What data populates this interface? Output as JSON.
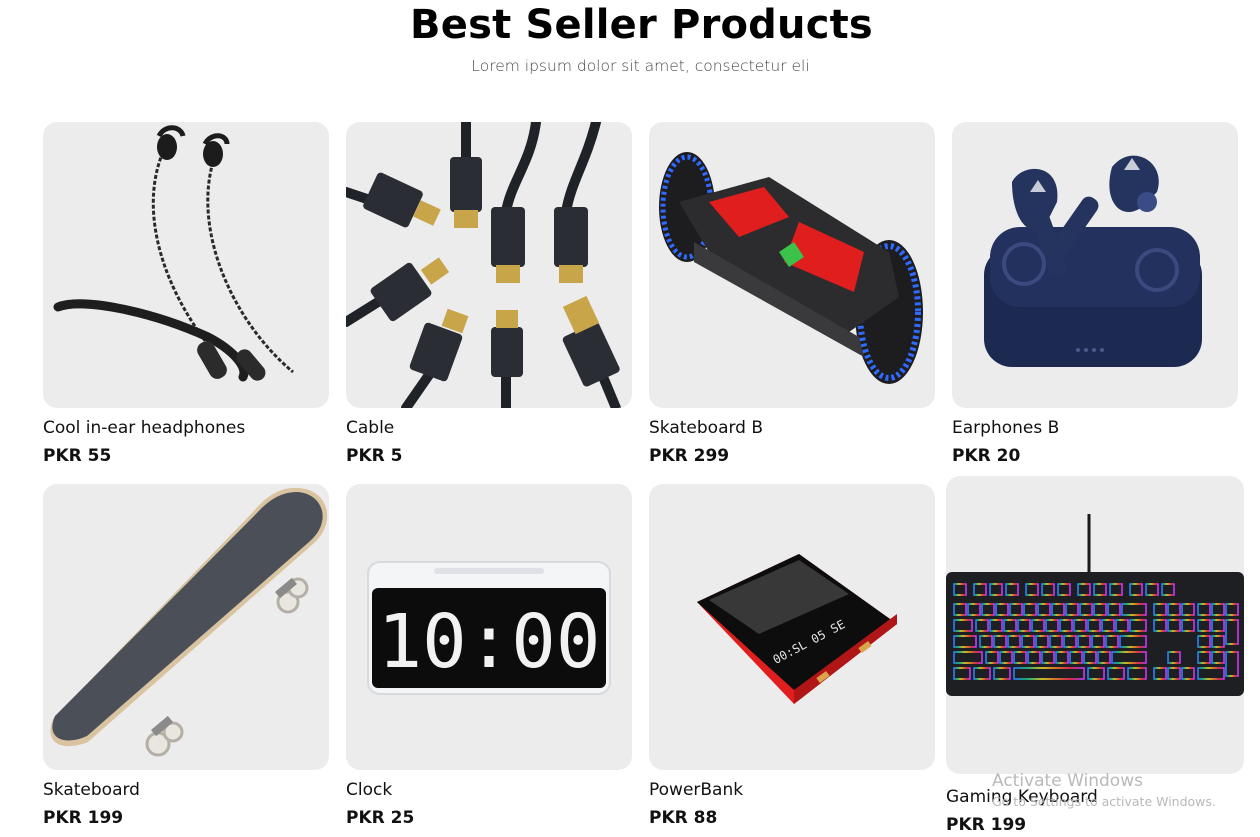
{
  "section": {
    "title": "Best Seller Products",
    "subtitle": "Lorem ipsum dolor sit amet, consectetur eli"
  },
  "products": [
    {
      "name": "Cool in-ear headphones",
      "price": "PKR 55",
      "icon": "neckband-headphones-image"
    },
    {
      "name": "Cable",
      "price": "PKR 5",
      "icon": "hdmi-cable-image"
    },
    {
      "name": "Skateboard B",
      "price": "PKR 299",
      "icon": "hoverboard-image"
    },
    {
      "name": "Earphones B",
      "price": "PKR 20",
      "icon": "earbuds-case-image"
    },
    {
      "name": "Skateboard",
      "price": "PKR 199",
      "icon": "skateboard-image"
    },
    {
      "name": "Clock",
      "price": "PKR 25",
      "icon": "digital-clock-image"
    },
    {
      "name": "PowerBank",
      "price": "PKR 88",
      "icon": "powerbank-image"
    },
    {
      "name": "Gaming Keyboard",
      "price": "PKR 199",
      "icon": "rgb-keyboard-image"
    }
  ],
  "clock_display": "10:00",
  "powerbank_display": "00:SL 05 SE",
  "watermark": {
    "line1": "Activate Windows",
    "line2": "Go to Settings to activate Windows."
  },
  "colors": {
    "card_background": "#ececec",
    "accent_red": "#e01e1e",
    "hoverboard_led": "#2f6bff"
  }
}
